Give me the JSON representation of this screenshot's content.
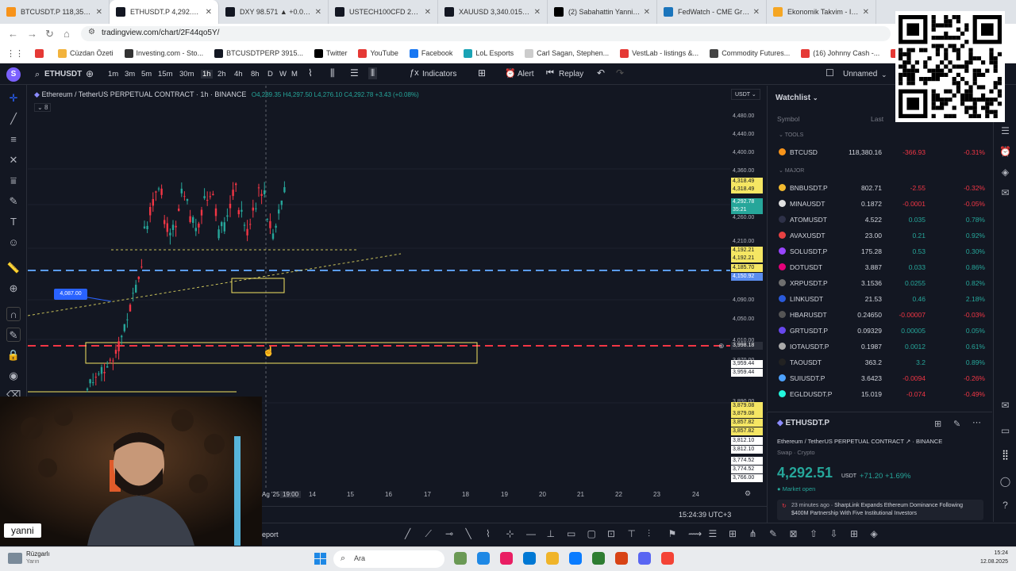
{
  "browser": {
    "tabs": [
      {
        "label": "BTCUSDT.P 118,352.2 ▼",
        "color": "#f7931a",
        "icon": "chart-icon"
      },
      {
        "label": "ETHUSDT.P 4,292.50 ▲ +",
        "color": "#131722",
        "icon": "chart-icon",
        "active": true
      },
      {
        "label": "DXY 98.571 ▲ +0.08% Un",
        "color": "#131722",
        "icon": "chart-icon"
      },
      {
        "label": "USTECH100CFD 23,558.0",
        "color": "#131722",
        "icon": "chart-icon"
      },
      {
        "label": "XAUUSD 3,340.015 ▼ -0",
        "color": "#131722",
        "icon": "chart-icon"
      },
      {
        "label": "(2) Sabahattin Yanni nokt",
        "color": "#000",
        "icon": "x-icon"
      },
      {
        "label": "FedWatch - CME Group",
        "color": "#1b75bc",
        "icon": "globe-icon"
      },
      {
        "label": "Ekonomik Takvim - Inves",
        "color": "#f5a623",
        "icon": "globe-icon"
      }
    ],
    "url": "tradingview.com/chart/2F44qo5Y/",
    "bookmarks": [
      {
        "label": "",
        "color": "#e53935"
      },
      {
        "label": "Cüzdan Özeti",
        "color": "#f2b33d"
      },
      {
        "label": "Investing.com - Sto...",
        "color": "#333"
      },
      {
        "label": "BTCUSDTPERP 3915...",
        "color": "#131722"
      },
      {
        "label": "Twitter",
        "color": "#000"
      },
      {
        "label": "YouTube",
        "color": "#e53935"
      },
      {
        "label": "Facebook",
        "color": "#1877f2"
      },
      {
        "label": "LoL Esports",
        "color": "#1aa3b5"
      },
      {
        "label": "Carl Sagan, Stephen...",
        "color": "#ccc"
      },
      {
        "label": "VestLab - listings &...",
        "color": "#e53935"
      },
      {
        "label": "Commodity Futures...",
        "color": "#444"
      },
      {
        "label": "(16) Johnny Cash -...",
        "color": "#e53935"
      },
      {
        "label": "(77) Bon Jovi - Livin...",
        "color": "#e53935"
      }
    ]
  },
  "toolbar": {
    "avatar": "S",
    "symbol": "ETHUSDT",
    "intervals": [
      "1m",
      "3m",
      "5m",
      "15m",
      "30m",
      "1h",
      "2h",
      "4h",
      "8h",
      "D",
      "W",
      "M"
    ],
    "active_interval": "1h",
    "indicators": "Indicators",
    "alert": "Alert",
    "replay": "Replay",
    "layout_name": "Unnamed"
  },
  "chart": {
    "title": "Ethereum / TetherUS PERPETUAL CONTRACT · 1h · BINANCE",
    "ohlc": "O4,289.35 H4,297.50 L4,276.10 C4,292.78 +3.43 (+0.08%)",
    "indicator_count": "8",
    "currency": "USDT",
    "price_labels": [
      "4,480.00",
      "4,440.00",
      "4,400.00",
      "4,360.00",
      "4,260.00",
      "4,210.00",
      "4,090.00",
      "4,050.00",
      "4,010.00",
      "3,970.00",
      "3,890.00"
    ],
    "price_boxes": [
      {
        "text": "4,318.49",
        "bg": "#f5e663",
        "fg": "#131722"
      },
      {
        "text": "4,318.49",
        "bg": "#f5e663",
        "fg": "#131722"
      },
      {
        "text": "4,292.78",
        "bg": "#26a69a",
        "fg": "#ffffff"
      },
      {
        "text": "35:21",
        "bg": "#26a69a",
        "fg": "#ffffff"
      },
      {
        "text": "4,192.21",
        "bg": "#f5e663",
        "fg": "#131722"
      },
      {
        "text": "4,192.21",
        "bg": "#f5e663",
        "fg": "#131722"
      },
      {
        "text": "4,185.70",
        "bg": "#f5e663",
        "fg": "#131722"
      },
      {
        "text": "4,150.92",
        "bg": "#5b8def",
        "fg": "#ffffff"
      },
      {
        "text": "3,998.18",
        "bg": "#2a2e39",
        "fg": "#ffffff"
      },
      {
        "text": "3,959.44",
        "bg": "#ffffff",
        "fg": "#131722"
      },
      {
        "text": "3,959.44",
        "bg": "#ffffff",
        "fg": "#131722"
      },
      {
        "text": "3,879.08",
        "bg": "#f5e663",
        "fg": "#131722"
      },
      {
        "text": "3,879.08",
        "bg": "#f5e663",
        "fg": "#131722"
      },
      {
        "text": "3,857.82",
        "bg": "#f5e663",
        "fg": "#131722"
      },
      {
        "text": "3,857.82",
        "bg": "#f5e663",
        "fg": "#131722"
      },
      {
        "text": "3,812.10",
        "bg": "#ffffff",
        "fg": "#131722"
      },
      {
        "text": "3,812.10",
        "bg": "#ffffff",
        "fg": "#131722"
      },
      {
        "text": "3,774.52",
        "bg": "#ffffff",
        "fg": "#131722"
      },
      {
        "text": "3,774.52",
        "bg": "#ffffff",
        "fg": "#131722"
      },
      {
        "text": "3,766.00",
        "bg": "#ffffff",
        "fg": "#131722"
      }
    ],
    "left_label": "4,087.00",
    "time_labels": [
      "Ag '25",
      "19:00",
      "14",
      "15",
      "16",
      "17",
      "18",
      "19",
      "20",
      "21",
      "22",
      "23",
      "24"
    ],
    "clock": "15:24:39 UTC+3",
    "report_label": "eport"
  },
  "watchlist": {
    "title": "Watchlist",
    "col_symbol": "Symbol",
    "col_last": "Last",
    "section_tools": "TOOLS",
    "section_major": "MAJOR",
    "rows": [
      {
        "symbol": "BTCUSD",
        "last": "118,380.16",
        "chg": "-366.93",
        "pct": "-0.31%",
        "color": "#f7931a",
        "dir": "neg"
      },
      {
        "symbol": "BNBUSDT.P",
        "last": "802.71",
        "chg": "-2.55",
        "pct": "-0.32%",
        "color": "#f3ba2f",
        "dir": "neg"
      },
      {
        "symbol": "MINAUSDT",
        "last": "0.1872",
        "chg": "-0.0001",
        "pct": "-0.05%",
        "color": "#e0e0e0",
        "dir": "neg"
      },
      {
        "symbol": "ATOMUSDT",
        "last": "4.522",
        "chg": "0.035",
        "pct": "0.78%",
        "color": "#2e3148",
        "dir": "pos"
      },
      {
        "symbol": "AVAXUSDT",
        "last": "23.00",
        "chg": "0.21",
        "pct": "0.92%",
        "color": "#e84142",
        "dir": "pos"
      },
      {
        "symbol": "SOLUSDT.P",
        "last": "175.28",
        "chg": "0.53",
        "pct": "0.30%",
        "color": "#9945ff",
        "dir": "pos"
      },
      {
        "symbol": "DOTUSDT",
        "last": "3.887",
        "chg": "0.033",
        "pct": "0.86%",
        "color": "#e6007a",
        "dir": "pos"
      },
      {
        "symbol": "XRPUSDT.P",
        "last": "3.1536",
        "chg": "0.0255",
        "pct": "0.82%",
        "color": "#6f6f6f",
        "dir": "pos"
      },
      {
        "symbol": "LINKUSDT",
        "last": "21.53",
        "chg": "0.46",
        "pct": "2.18%",
        "color": "#2a5ada",
        "dir": "pos"
      },
      {
        "symbol": "HBARUSDT",
        "last": "0.24650",
        "chg": "-0.00007",
        "pct": "-0.03%",
        "color": "#555",
        "dir": "neg"
      },
      {
        "symbol": "GRTUSDT.P",
        "last": "0.09329",
        "chg": "0.00005",
        "pct": "0.05%",
        "color": "#6747ed",
        "dir": "pos"
      },
      {
        "symbol": "IOTAUSDT.P",
        "last": "0.1987",
        "chg": "0.0012",
        "pct": "0.61%",
        "color": "#aaa",
        "dir": "pos"
      },
      {
        "symbol": "TAOUSDT",
        "last": "363.2",
        "chg": "3.2",
        "pct": "0.89%",
        "color": "#222",
        "dir": "pos"
      },
      {
        "symbol": "SUIUSDT.P",
        "last": "3.6423",
        "chg": "-0.0094",
        "pct": "-0.26%",
        "color": "#4da2ff",
        "dir": "neg"
      },
      {
        "symbol": "EGLDUSDT.P",
        "last": "15.019",
        "chg": "-0.074",
        "pct": "-0.49%",
        "color": "#23f7dd",
        "dir": "neg"
      }
    ]
  },
  "details": {
    "symbol": "ETHUSDT.P",
    "name": "Ethereum / TetherUS PERPETUAL CONTRACT",
    "exchange": "BINANCE",
    "type": "Swap · Crypto",
    "price": "4,292.51",
    "currency": "USDT",
    "change": "+71.20",
    "change_pct": "+1.69%",
    "status": "Market open",
    "news_time": "23 minutes ago",
    "news_text": "SharpLink Expands Ethereum Dominance Following $400M Partnership With Five Institutional Investors"
  },
  "webcam": {
    "name": "yanni"
  },
  "taskbar": {
    "weather_title": "Rüzgarlı",
    "weather_sub": "Yarın",
    "search": "Ara",
    "time": "15:24",
    "date": "12.08.2025"
  }
}
